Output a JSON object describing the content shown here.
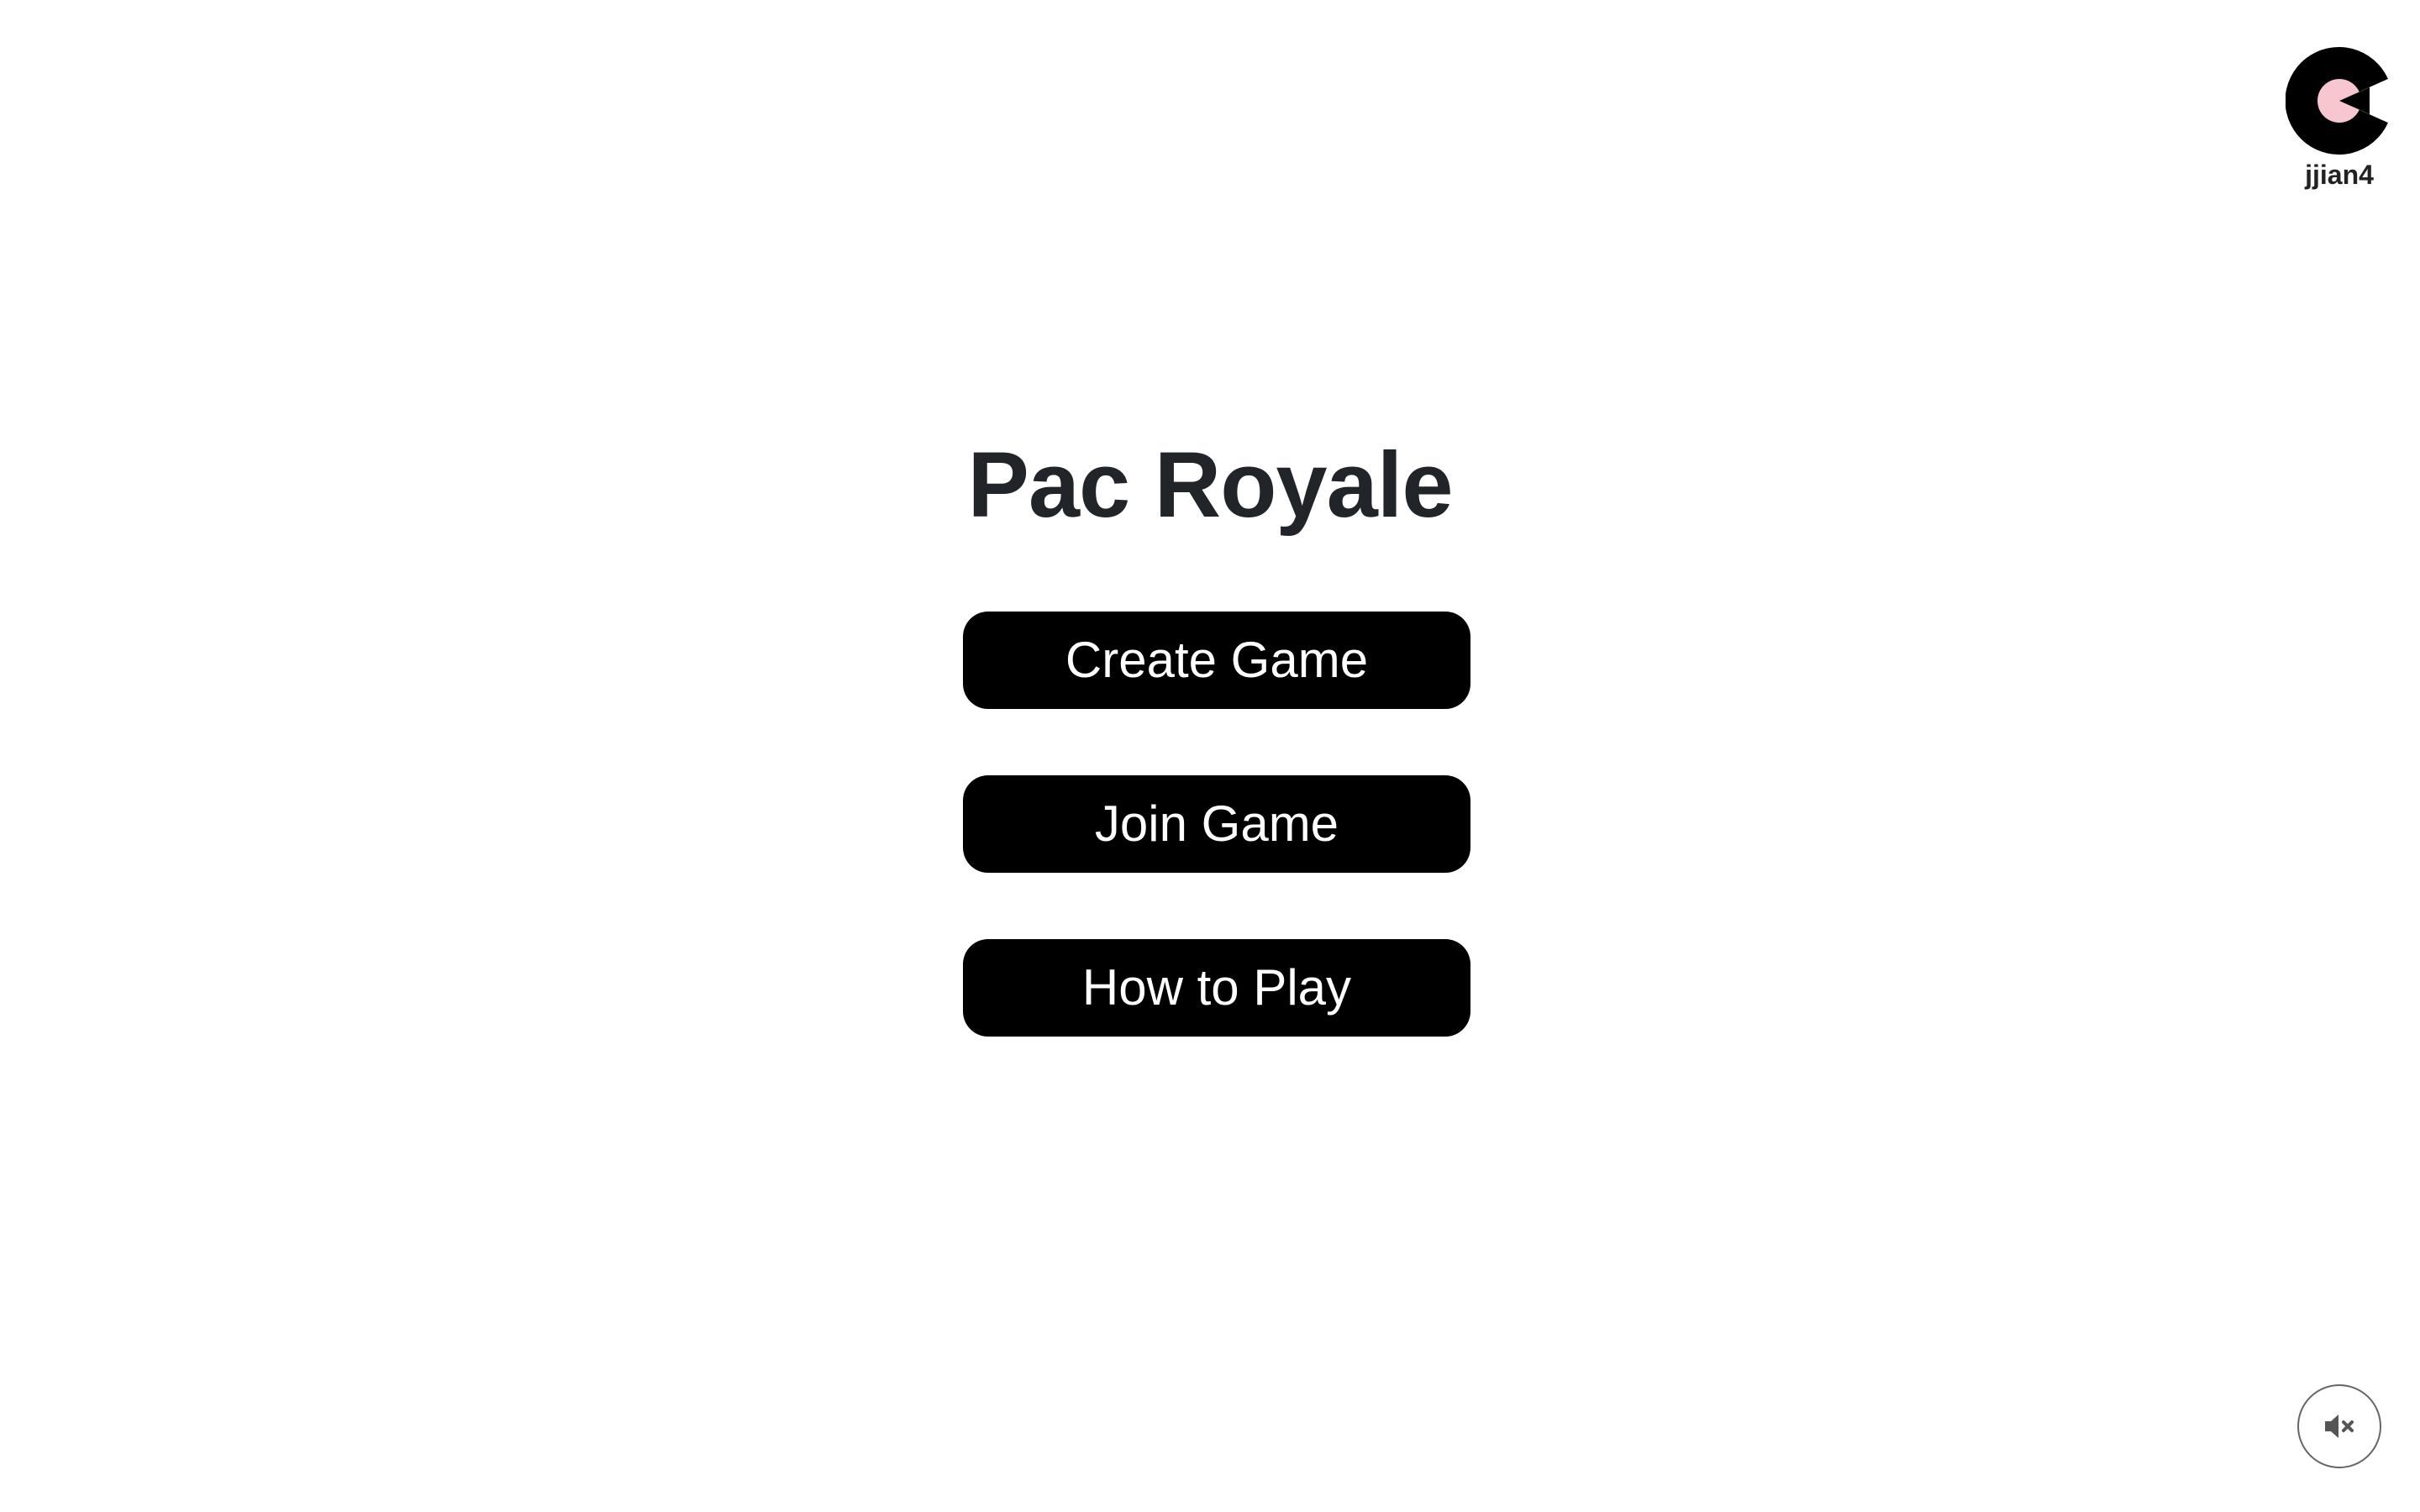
{
  "app": {
    "title": "Pac Royale"
  },
  "profile": {
    "avatar_icon": "pacman-avatar-icon",
    "avatar_color": "#000000",
    "avatar_inner_color": "#f7c6cf",
    "username": "jjian4"
  },
  "menu": {
    "buttons": [
      {
        "label": "Create Game"
      },
      {
        "label": "Join Game"
      },
      {
        "label": "How to Play"
      }
    ],
    "button_color": "#000000",
    "button_text_color": "#ffffff"
  },
  "sound": {
    "icon": "volume-mute-icon",
    "state": "muted"
  }
}
